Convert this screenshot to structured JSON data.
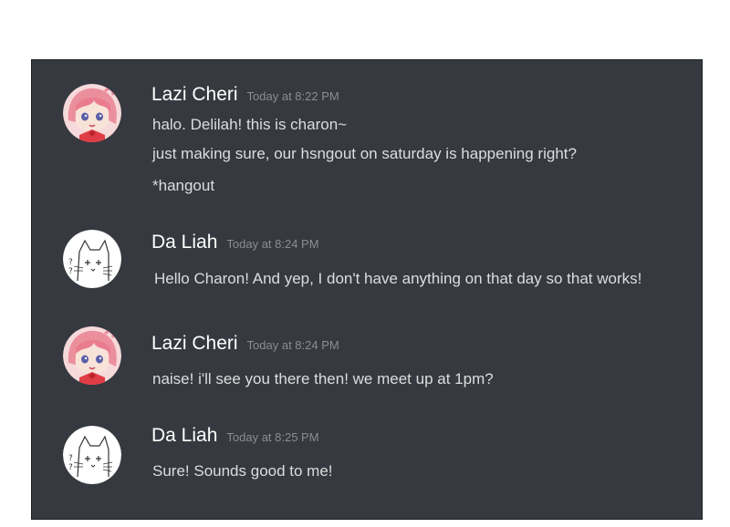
{
  "messages": [
    {
      "author": "Lazi Cheri",
      "timestamp": "Today at 8:22 PM",
      "avatar_icon": "anime-girl-pink-hair-icon",
      "lines": [
        "halo. Delilah! this is charon~",
        "just making sure, our hsngout on saturday is happening right?",
        "*hangout"
      ]
    },
    {
      "author": "Da Liah",
      "timestamp": "Today at 8:24 PM",
      "avatar_icon": "cat-sketch-icon",
      "lines": [
        "Hello Charon! And yep, I don't have anything on that day so that works!"
      ]
    },
    {
      "author": "Lazi Cheri",
      "timestamp": "Today at 8:24 PM",
      "avatar_icon": "anime-girl-pink-hair-icon",
      "lines": [
        "naise! i'll see you there then! we meet up at 1pm?"
      ]
    },
    {
      "author": "Da Liah",
      "timestamp": "Today at 8:25 PM",
      "avatar_icon": "cat-sketch-icon",
      "lines": [
        "Sure! Sounds good to me!"
      ]
    }
  ],
  "colors": {
    "panel_background": "#36393f",
    "username": "#ffffff",
    "timestamp": "#8a8d93",
    "message_text": "#dcddde"
  }
}
